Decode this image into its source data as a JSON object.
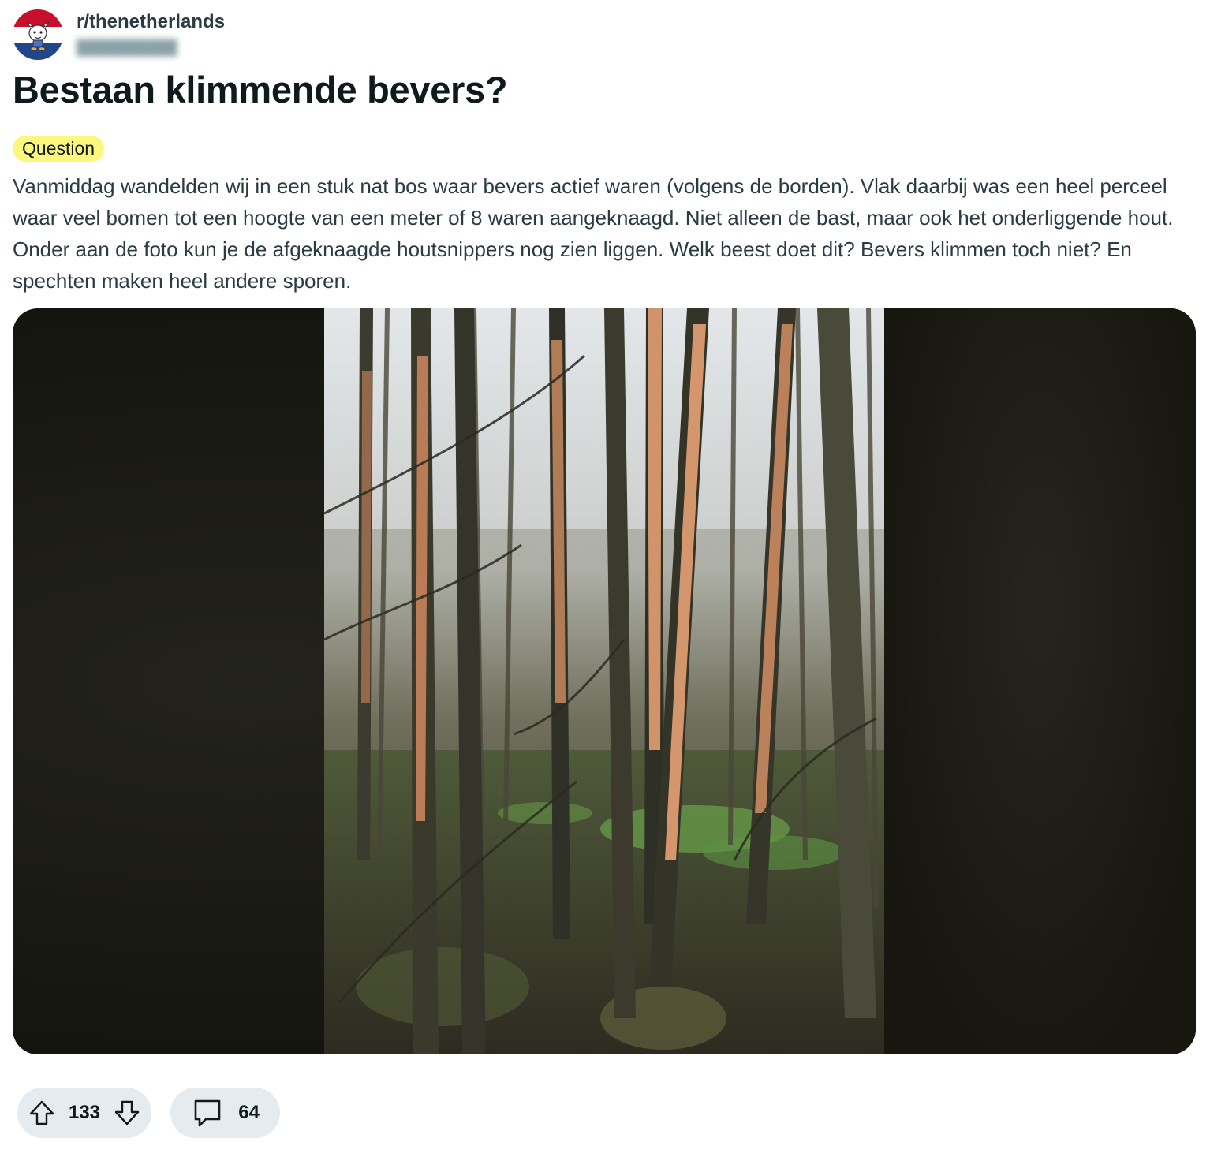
{
  "post": {
    "subreddit": "r/thenetherlands",
    "title": "Bestaan klimmende bevers?",
    "flair": {
      "label": "Question",
      "color": "#fdf77e"
    },
    "body": "Vanmiddag wandelden wij in een stuk nat bos waar bevers actief waren (volgens de borden). Vlak daarbij was een heel perceel waar veel bomen tot een hoogte van een meter of 8 waren aangeknaagd. Niet alleen de bast, maar ook het onderliggende hout. Onder aan de foto kun je de afgeknaagde houtsnippers nog zien liggen. Welk beest doet dit? Bevers klimmen toch niet? En spechten maken heel andere sporen."
  },
  "actions": {
    "upvote_icon": "arrow-up-icon",
    "score": "133",
    "downvote_icon": "arrow-down-icon",
    "comment_icon": "speech-bubble-icon",
    "comments": "64"
  },
  "colors": {
    "pill_bg": "#e5ebee",
    "text": "#0f1a1c",
    "body_text": "#2a3c42"
  }
}
